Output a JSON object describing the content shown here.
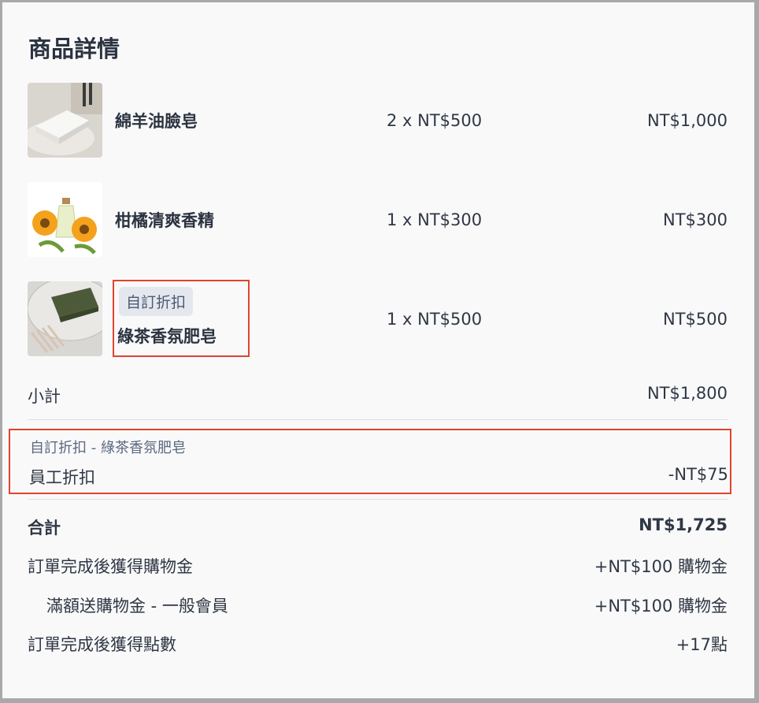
{
  "title": "商品詳情",
  "items": [
    {
      "name": "綿羊油臉皂",
      "qty": "2 x NT$500",
      "total": "NT$1,000",
      "image": "white-soap-bar-photo"
    },
    {
      "name": "柑橘清爽香精",
      "qty": "1 x NT$300",
      "total": "NT$300",
      "image": "orange-flowers-oil-bottle-photo"
    },
    {
      "name": "綠茶香氛肥皂",
      "qty": "1 x NT$500",
      "total": "NT$500",
      "image": "green-tea-soap-on-dish-photo",
      "badge": "自訂折扣"
    }
  ],
  "subtotal": {
    "label": "小計",
    "value": "NT$1,800"
  },
  "discount": {
    "sub": "自訂折扣 - 綠茶香氛肥皂",
    "label": "員工折扣",
    "value": "-NT$75"
  },
  "total": {
    "label": "合計",
    "value": "NT$1,725"
  },
  "rewards": [
    {
      "label": "訂單完成後獲得購物金",
      "value": "+NT$100 購物金"
    },
    {
      "label": "滿額送購物金 - 一般會員",
      "value": "+NT$100 購物金"
    },
    {
      "label": "訂單完成後獲得點數",
      "value": "+17點"
    }
  ],
  "colors": {
    "highlight": "#e0442d",
    "badge_bg": "#e4e7ee",
    "text": "#2f3744"
  }
}
